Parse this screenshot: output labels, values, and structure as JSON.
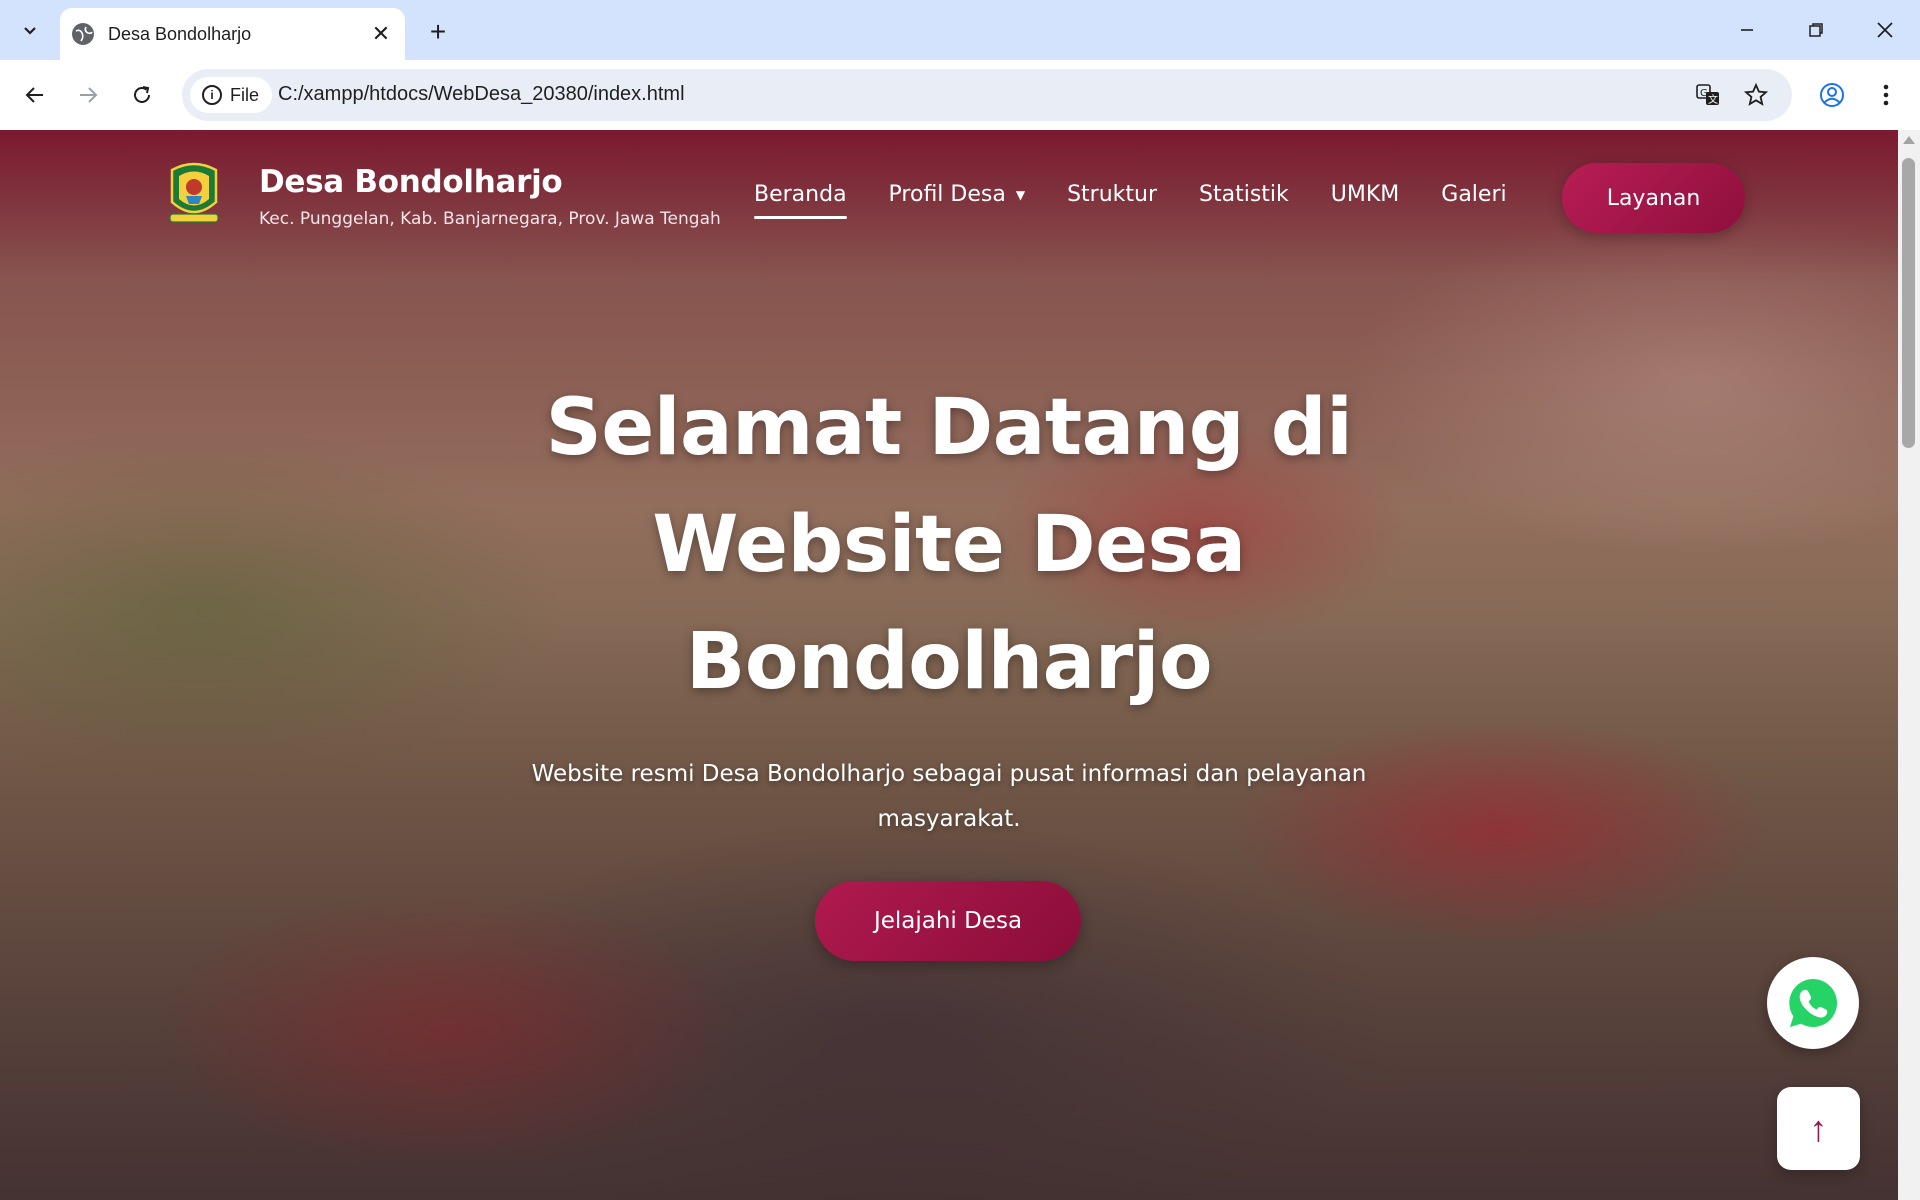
{
  "browser": {
    "tab_title": "Desa Bondolharjo",
    "site_chip_label": "File",
    "url": "C:/xampp/htdocs/WebDesa_20380/index.html",
    "icons": [
      "tab-list-icon",
      "globe-icon",
      "close-icon",
      "plus-icon",
      "minimize-icon",
      "restore-icon",
      "window-close-icon",
      "back-icon",
      "forward-icon",
      "reload-icon",
      "info-icon",
      "translate-icon",
      "star-icon",
      "profile-icon",
      "more-icon"
    ]
  },
  "site": {
    "brand_name": "Desa Bondolharjo",
    "brand_sub": "Kec. Punggelan, Kab. Banjarnegara, Prov. Jawa Tengah",
    "nav": [
      {
        "label": "Beranda",
        "active": true
      },
      {
        "label": "Profil Desa",
        "has_dropdown": true
      },
      {
        "label": "Struktur"
      },
      {
        "label": "Statistik"
      },
      {
        "label": "UMKM"
      },
      {
        "label": "Galeri"
      }
    ],
    "cta_label": "Layanan",
    "hero_title_line1": "Selamat Datang di",
    "hero_title_line2": "Website Desa",
    "hero_title_line3": "Bondolharjo",
    "hero_sub_line1": "Website resmi Desa Bondolharjo sebagai pusat informasi dan pelayanan",
    "hero_sub_line2": "masyarakat.",
    "explore_label": "Jelajahi Desa",
    "back_to_top_glyph": "↑",
    "accent_color": "#a0174a"
  }
}
